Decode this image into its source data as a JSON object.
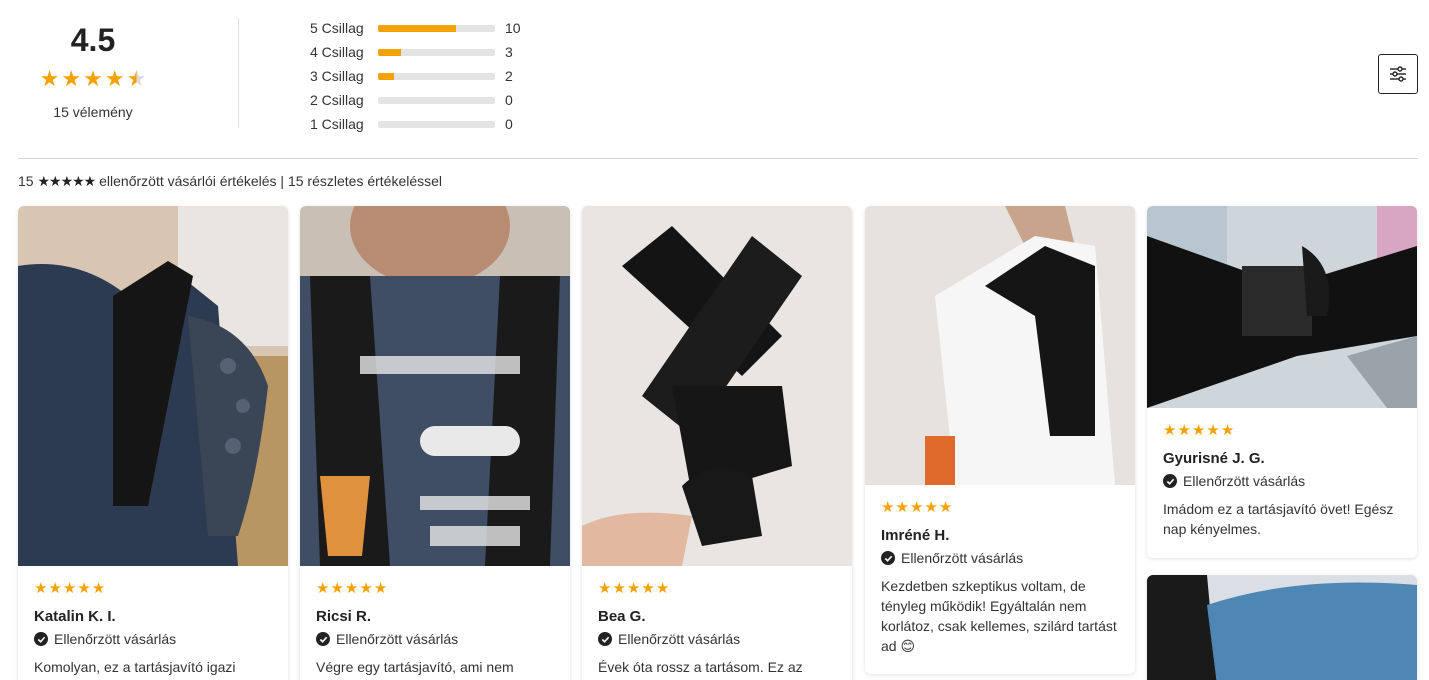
{
  "summary": {
    "average": "4.5",
    "average_value": 4.5,
    "review_count_label": "15 vélemény",
    "distribution": [
      {
        "label": "5 Csillag",
        "count": "10",
        "fraction": 0.667
      },
      {
        "label": "4 Csillag",
        "count": "3",
        "fraction": 0.2
      },
      {
        "label": "3 Csillag",
        "count": "2",
        "fraction": 0.133
      },
      {
        "label": "2 Csillag",
        "count": "0",
        "fraction": 0
      },
      {
        "label": "1  Csillag",
        "count": "0",
        "fraction": 0
      }
    ]
  },
  "verified_line": {
    "count": "15",
    "stars": "★★★★★",
    "text": "ellenőrzött vásárlói értékelés | 15 részletes értékeléssel"
  },
  "filter": {
    "icon": "sliders-icon"
  },
  "colors": {
    "accent": "#f5a200",
    "text": "#222222",
    "bar_track": "#e4e4e4"
  },
  "verified_label": "Ellenőrzött vásárlás",
  "reviews": [
    {
      "author": "Katalin K. I.",
      "rating": 5,
      "text": "Komolyan, ez a tartásjavító igazi"
    },
    {
      "author": "Ricsi R.",
      "rating": 5,
      "text": "Végre egy tartásjavító, ami nem"
    },
    {
      "author": "Bea G.",
      "rating": 5,
      "text": "Évek óta rossz a tartásom. Ez az"
    },
    {
      "author": "Imréné H.",
      "rating": 5,
      "text": "Kezdetben szkeptikus voltam, de tényleg működik! Egyáltalán nem korlátoz, csak kellemes, szilárd tartást ad 😊"
    },
    {
      "author": "Gyurisné J. G.",
      "rating": 5,
      "text": "Imádom ez a tartásjavító övet! Egész nap kényelmes."
    }
  ]
}
